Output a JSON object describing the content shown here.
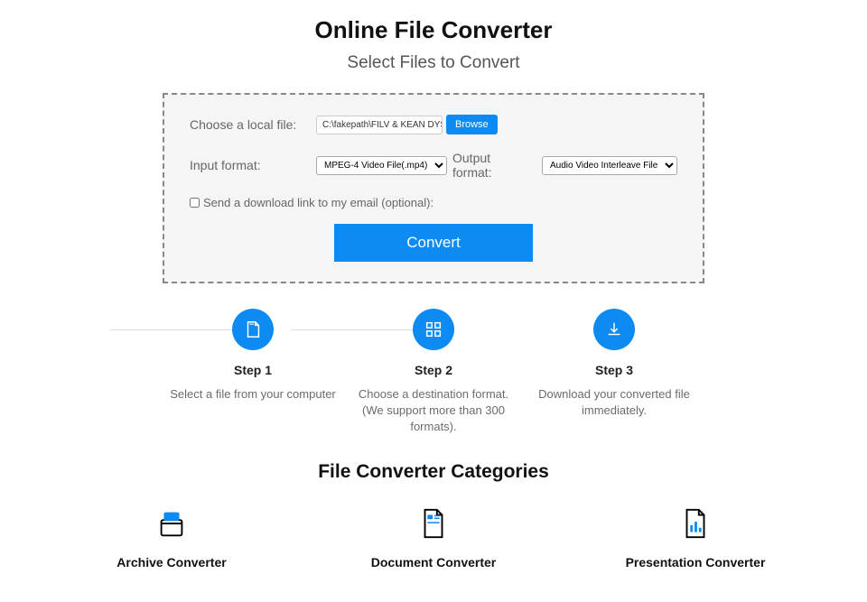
{
  "header": {
    "title": "Online File Converter",
    "subtitle": "Select Files to Convert"
  },
  "panel": {
    "choose_label": "Choose a local file:",
    "file_display": "C:\\fakepath\\FILV & KEAN DYSSO - All Th",
    "browse_label": "Browse",
    "input_format_label": "Input format:",
    "input_format_value": "MPEG-4 Video File(.mp4)",
    "output_format_label": "Output format:",
    "output_format_value": "Audio Video Interleave File",
    "email_label": "Send a download link to my email (optional):",
    "convert_label": "Convert"
  },
  "steps": [
    {
      "title": "Step 1",
      "desc": "Select a file from your computer"
    },
    {
      "title": "Step 2",
      "desc": "Choose a destination format. (We support more than 300 formats)."
    },
    {
      "title": "Step 3",
      "desc": "Download your converted file immediately."
    }
  ],
  "categories_title": "File Converter Categories",
  "categories": [
    {
      "title": "Archive Converter"
    },
    {
      "title": "Document Converter"
    },
    {
      "title": "Presentation Converter"
    }
  ]
}
